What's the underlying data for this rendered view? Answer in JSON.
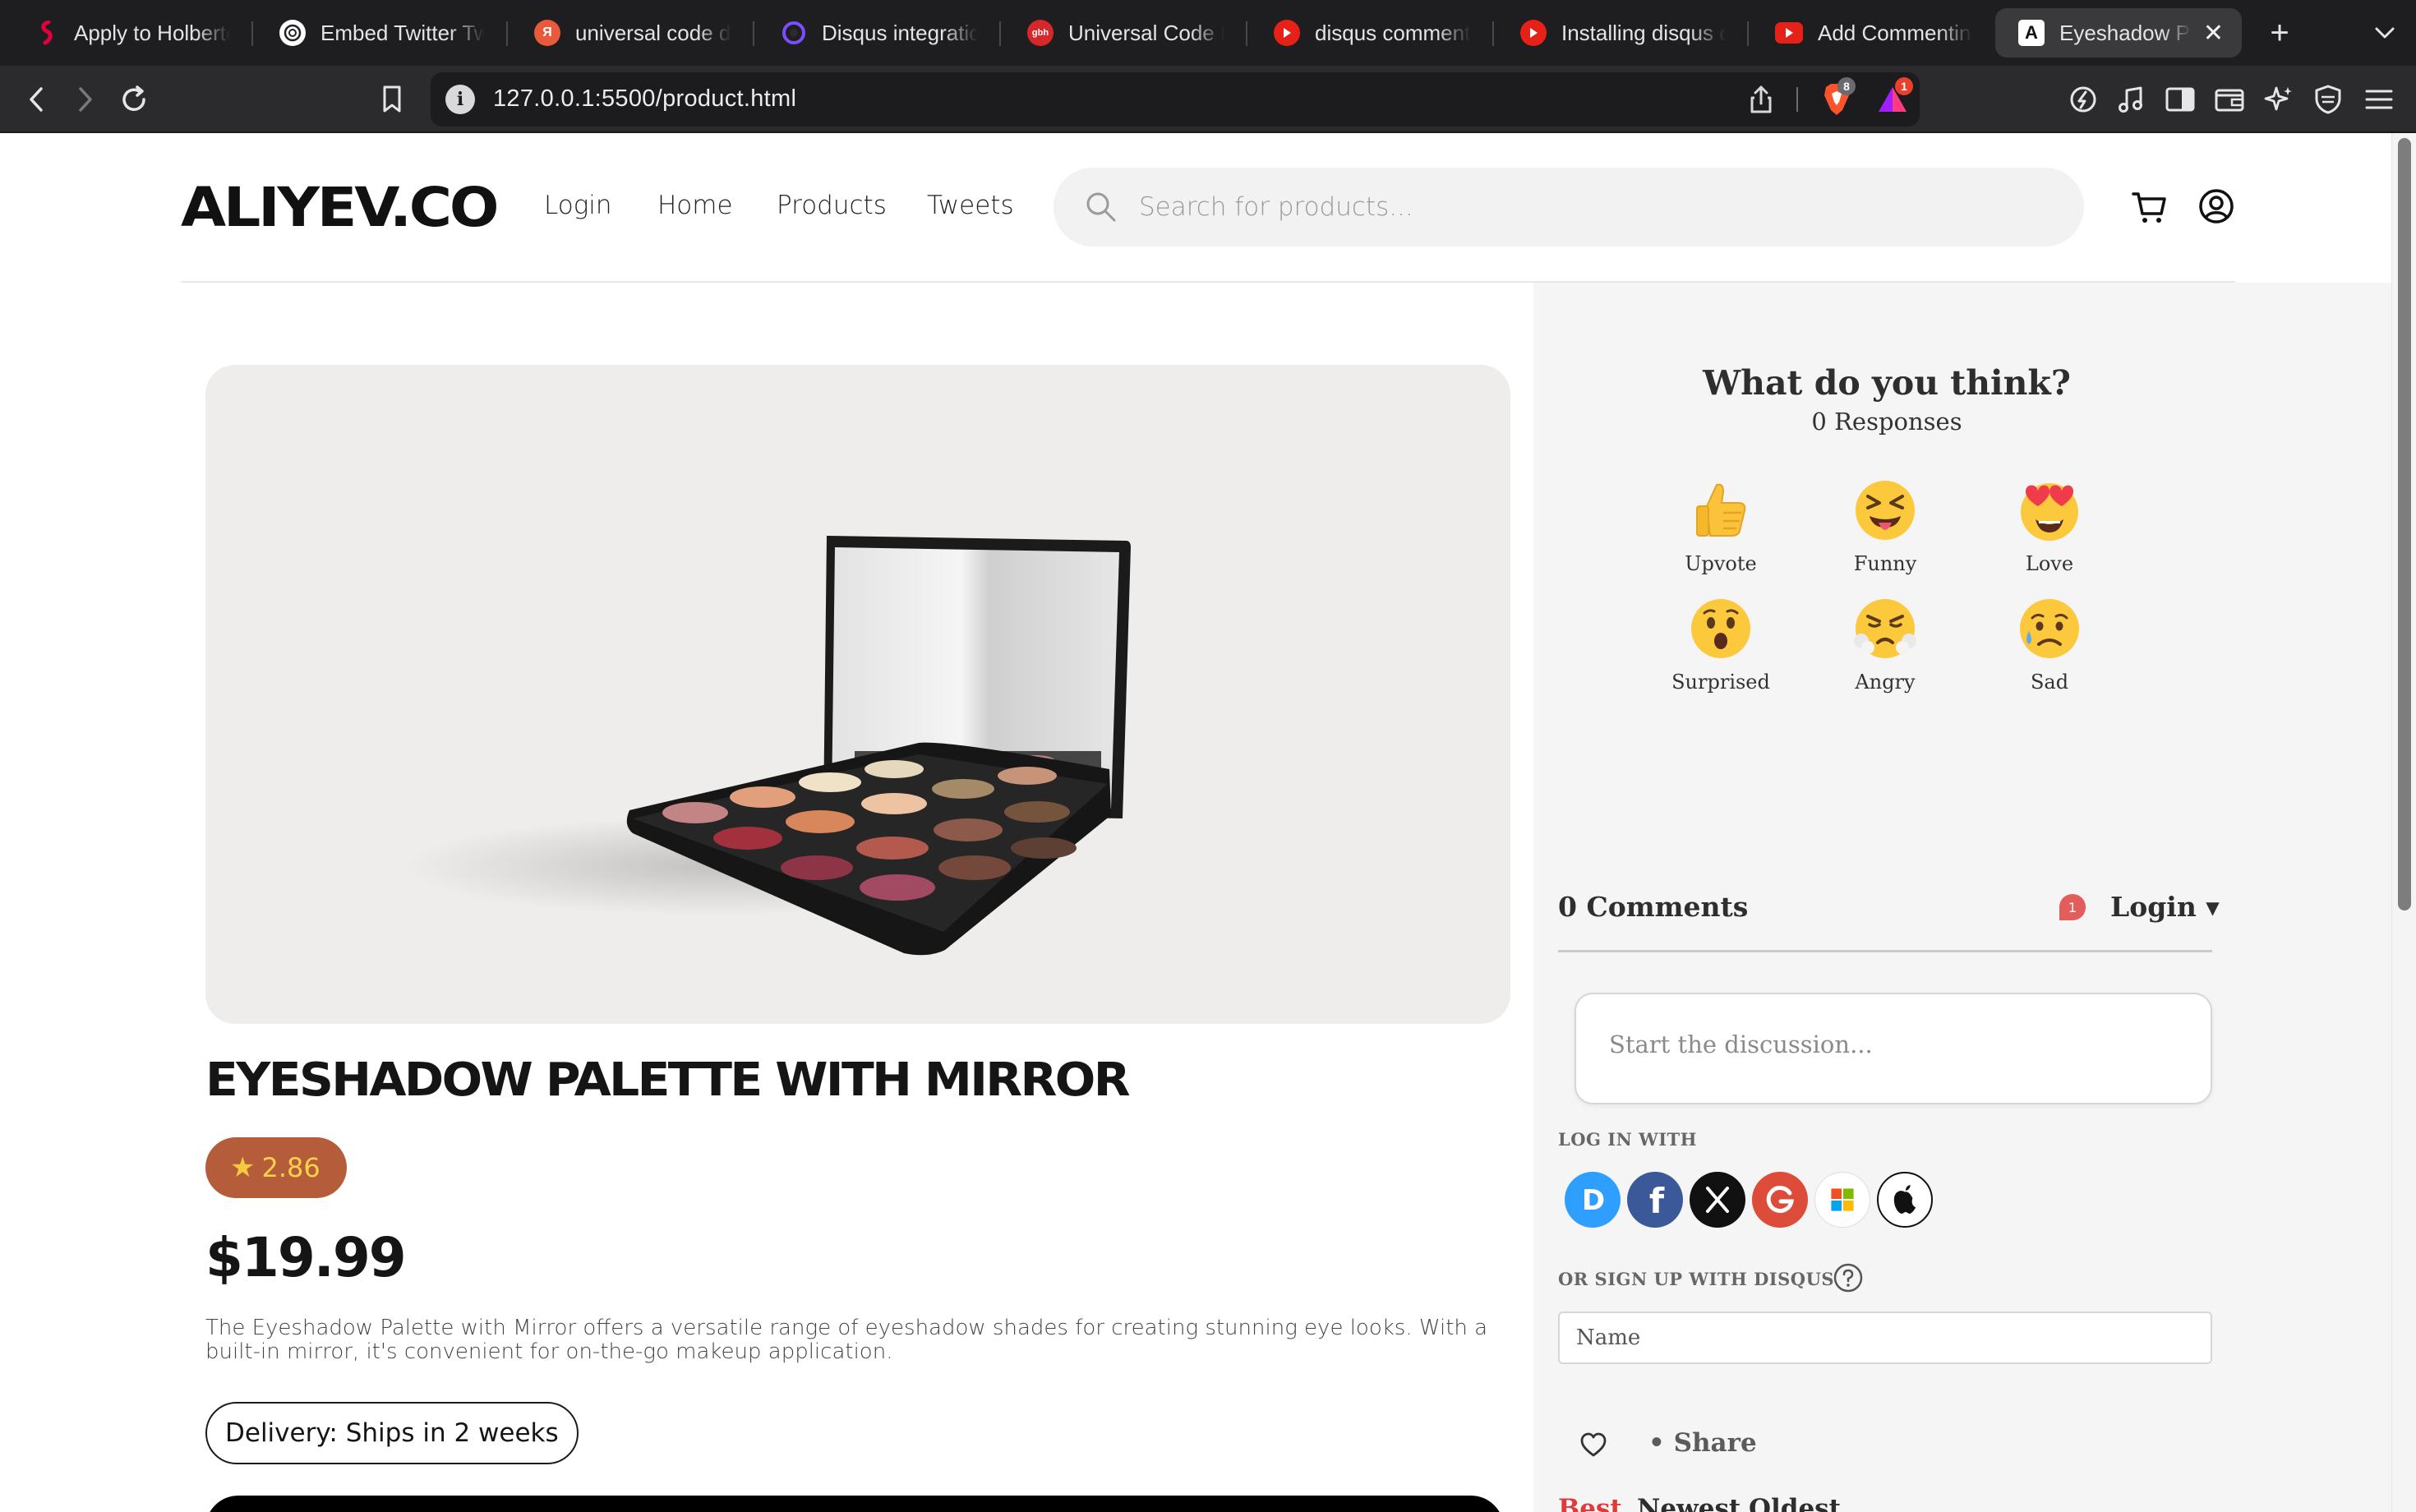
{
  "browser": {
    "tabs": [
      {
        "title": "Apply to Holberton",
        "icon": "holberton-icon",
        "color": "#e1003e"
      },
      {
        "title": "Embed Twitter Tweets",
        "icon": "openai-icon",
        "color": "#555555"
      },
      {
        "title": "universal code disqus",
        "icon": "yandex-icon",
        "color": "#e85a3b"
      },
      {
        "title": "Disqus integration",
        "icon": "disqus-ring-icon",
        "color": "#7c4dff"
      },
      {
        "title": "Universal Code Example",
        "icon": "gbh-icon",
        "color": "#d6282b"
      },
      {
        "title": "disqus comment using",
        "icon": "youtube-icon",
        "color": "#e62117"
      },
      {
        "title": "Installing disqus on",
        "icon": "youtube-icon",
        "color": "#e62117"
      },
      {
        "title": "Add Commenting",
        "icon": "youtube-icon",
        "color": "#e62117"
      },
      {
        "title": "Eyeshadow Palette",
        "icon": "site-a-icon",
        "color": "#ffffff"
      }
    ],
    "active_tab_index": 8,
    "url": "127.0.0.1:5500/product.html",
    "shield_badge": "8",
    "rewards_badge": "1"
  },
  "site": {
    "logo": "ALIYEV.CO",
    "nav": [
      "Login",
      "Home",
      "Products",
      "Tweets"
    ],
    "search_placeholder": "Search for products..."
  },
  "product": {
    "title": "Eyeshadow Palette with Mirror",
    "rating": "2.86",
    "price": "$19.99",
    "description": "The Eyeshadow Palette with Mirror offers a versatile range of eyeshadow shades for creating stunning eye looks. With a built-in mirror, it's convenient for on-the-go makeup application.",
    "delivery": "Delivery: Ships in 2 weeks"
  },
  "disqus": {
    "question": "What do you think?",
    "responses": "0 Responses",
    "reactions": [
      {
        "label": "Upvote",
        "icon": "thumbs-up-icon"
      },
      {
        "label": "Funny",
        "icon": "squinting-tongue-icon"
      },
      {
        "label": "Love",
        "icon": "heart-eyes-icon"
      },
      {
        "label": "Surprised",
        "icon": "hushed-face-icon"
      },
      {
        "label": "Angry",
        "icon": "steam-face-icon"
      },
      {
        "label": "Sad",
        "icon": "sad-tear-face-icon"
      }
    ],
    "comments_heading": "0 Comments",
    "notification_count": "1",
    "login_label": "Login ▾",
    "comment_placeholder": "Start the discussion...",
    "login_with": "Log in with",
    "signup_with": "or sign up with Disqus",
    "name_placeholder": "Name",
    "share_label": "• Share",
    "sort": [
      "Best",
      "Newest",
      "Oldest"
    ],
    "active_sort": "Best",
    "socials": [
      {
        "name": "disqus",
        "letter": "D",
        "color": "#2e9fff"
      },
      {
        "name": "facebook",
        "letter": "f",
        "color": "#3b5998"
      },
      {
        "name": "x",
        "letter": "𝕏",
        "color": "#111111"
      },
      {
        "name": "google",
        "letter": "G",
        "color": "#dd4b39"
      },
      {
        "name": "microsoft",
        "letter": "",
        "color": "#ffffff"
      },
      {
        "name": "apple",
        "letter": "",
        "color": "#ffffff"
      }
    ]
  }
}
